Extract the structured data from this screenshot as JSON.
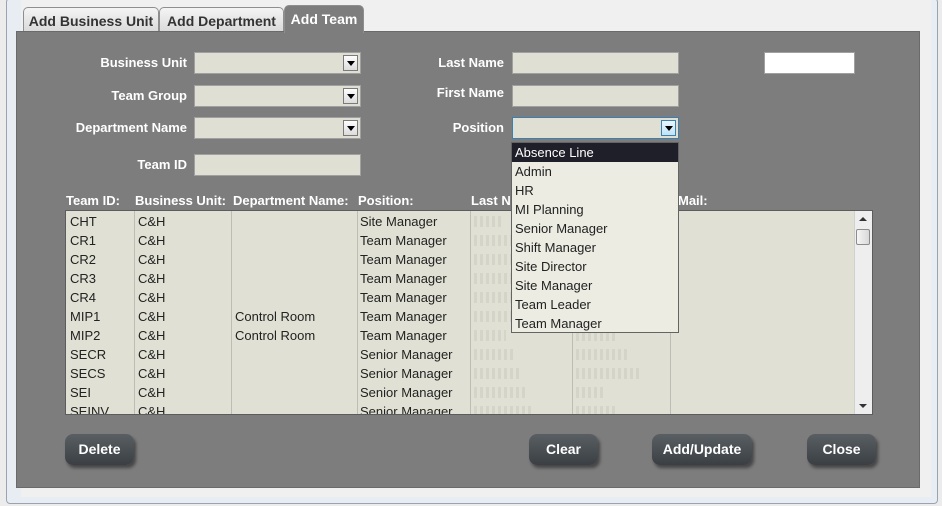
{
  "tabs": [
    {
      "label": "Add Business Unit"
    },
    {
      "label": "Add Department"
    },
    {
      "label": "Add Team"
    }
  ],
  "form": {
    "business_unit_label": "Business Unit",
    "team_group_label": "Team Group",
    "department_name_label": "Department Name",
    "team_id_label": "Team ID",
    "last_name_label": "Last Name",
    "first_name_label": "First Name",
    "position_label": "Position"
  },
  "columns": {
    "team_id": "Team ID:",
    "business_unit": "Business Unit:",
    "department_name": "Department Name:",
    "position": "Position:",
    "last_name": "Last Na",
    "mail": "Mail:"
  },
  "rows": [
    {
      "team_id": "CHT",
      "business_unit": "C&H",
      "department": "",
      "position": "Site Manager"
    },
    {
      "team_id": "CR1",
      "business_unit": "C&H",
      "department": "",
      "position": "Team Manager"
    },
    {
      "team_id": "CR2",
      "business_unit": "C&H",
      "department": "",
      "position": "Team Manager"
    },
    {
      "team_id": "CR3",
      "business_unit": "C&H",
      "department": "",
      "position": "Team Manager"
    },
    {
      "team_id": "CR4",
      "business_unit": "C&H",
      "department": "",
      "position": "Team Manager"
    },
    {
      "team_id": "MIP1",
      "business_unit": "C&H",
      "department": "Control Room",
      "position": "Team Manager"
    },
    {
      "team_id": "MIP2",
      "business_unit": "C&H",
      "department": "Control Room",
      "position": "Team Manager"
    },
    {
      "team_id": "SECR",
      "business_unit": "C&H",
      "department": "",
      "position": "Senior Manager"
    },
    {
      "team_id": "SECS",
      "business_unit": "C&H",
      "department": "",
      "position": "Senior Manager"
    },
    {
      "team_id": "SEI",
      "business_unit": "C&H",
      "department": "",
      "position": "Senior Manager"
    },
    {
      "team_id": "SEINV",
      "business_unit": "C&H",
      "department": "",
      "position": "Senior Manager"
    }
  ],
  "position_options": [
    "Absence Line",
    "Admin",
    "HR",
    "MI Planning",
    "Senior Manager",
    "Shift Manager",
    "Site Director",
    "Site Manager",
    "Team Leader",
    "Team Manager"
  ],
  "buttons": {
    "delete": "Delete",
    "clear": "Clear",
    "add_update": "Add/Update",
    "close": "Close"
  }
}
